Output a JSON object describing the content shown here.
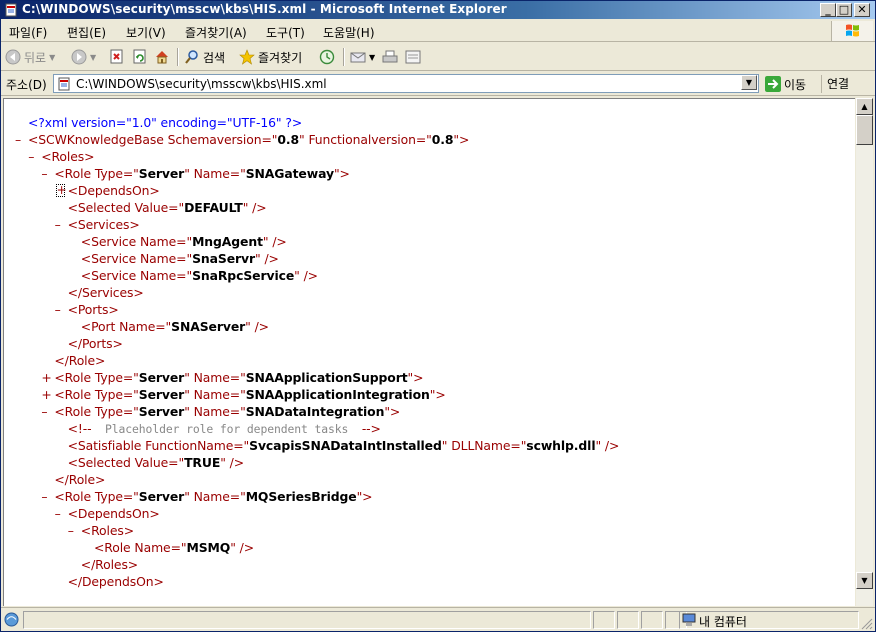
{
  "window": {
    "title": "C:\\WINDOWS\\security\\msscw\\kbs\\HIS.xml - Microsoft Internet Explorer",
    "min_label": "_",
    "max_label": "□",
    "close_label": "✕"
  },
  "menu": {
    "items": [
      "파일(F)",
      "편집(E)",
      "보기(V)",
      "즐겨찾기(A)",
      "도구(T)",
      "도움말(H)"
    ]
  },
  "toolbar": {
    "back_label": "뒤로",
    "search_label": "검색",
    "favorites_label": "즐겨찾기"
  },
  "address": {
    "label": "주소(D)",
    "value": "C:\\WINDOWS\\security\\msscw\\kbs\\HIS.xml",
    "go_label": "이동",
    "links_label": "연결"
  },
  "status": {
    "zone": "내 컴퓨터"
  },
  "xml_lines": [
    {
      "marker": "",
      "indent": 0,
      "parts": [
        {
          "c": "pi",
          "t": "<?xml version=\"1.0\" encoding=\"UTF-16\" ?>"
        }
      ]
    },
    {
      "marker": "-",
      "indent": 0,
      "parts": [
        {
          "c": "tg",
          "t": "<SCWKnowledgeBase "
        },
        {
          "c": "at",
          "t": "Schemaversion=\""
        },
        {
          "c": "vl",
          "t": "0.8"
        },
        {
          "c": "at",
          "t": "\" Functionalversion=\""
        },
        {
          "c": "vl",
          "t": "0.8"
        },
        {
          "c": "tg",
          "t": "\">"
        }
      ]
    },
    {
      "marker": "-",
      "indent": 1,
      "parts": [
        {
          "c": "tg",
          "t": "<Roles>"
        }
      ]
    },
    {
      "marker": "-",
      "indent": 2,
      "parts": [
        {
          "c": "tg",
          "t": "<Role "
        },
        {
          "c": "at",
          "t": "Type=\""
        },
        {
          "c": "vl",
          "t": "Server"
        },
        {
          "c": "at",
          "t": "\" Name=\""
        },
        {
          "c": "vl",
          "t": "SNAGateway"
        },
        {
          "c": "tg",
          "t": "\">"
        }
      ]
    },
    {
      "marker": "+box",
      "indent": 3,
      "parts": [
        {
          "c": "tg",
          "t": "<DependsOn>"
        }
      ]
    },
    {
      "marker": "",
      "indent": 3,
      "parts": [
        {
          "c": "tg",
          "t": "<Selected "
        },
        {
          "c": "at",
          "t": "Value=\""
        },
        {
          "c": "vl",
          "t": "DEFAULT"
        },
        {
          "c": "tg",
          "t": "\" />"
        }
      ]
    },
    {
      "marker": "-",
      "indent": 3,
      "parts": [
        {
          "c": "tg",
          "t": "<Services>"
        }
      ]
    },
    {
      "marker": "",
      "indent": 4,
      "parts": [
        {
          "c": "tg",
          "t": "<Service "
        },
        {
          "c": "at",
          "t": "Name=\""
        },
        {
          "c": "vl",
          "t": "MngAgent"
        },
        {
          "c": "tg",
          "t": "\" />"
        }
      ]
    },
    {
      "marker": "",
      "indent": 4,
      "parts": [
        {
          "c": "tg",
          "t": "<Service "
        },
        {
          "c": "at",
          "t": "Name=\""
        },
        {
          "c": "vl",
          "t": "SnaServr"
        },
        {
          "c": "tg",
          "t": "\" />"
        }
      ]
    },
    {
      "marker": "",
      "indent": 4,
      "parts": [
        {
          "c": "tg",
          "t": "<Service "
        },
        {
          "c": "at",
          "t": "Name=\""
        },
        {
          "c": "vl",
          "t": "SnaRpcService"
        },
        {
          "c": "tg",
          "t": "\" />"
        }
      ]
    },
    {
      "marker": "",
      "indent": 3,
      "parts": [
        {
          "c": "tg",
          "t": "</Services>"
        }
      ]
    },
    {
      "marker": "-",
      "indent": 3,
      "parts": [
        {
          "c": "tg",
          "t": "<Ports>"
        }
      ]
    },
    {
      "marker": "",
      "indent": 4,
      "parts": [
        {
          "c": "tg",
          "t": "<Port "
        },
        {
          "c": "at",
          "t": "Name=\""
        },
        {
          "c": "vl",
          "t": "SNAServer"
        },
        {
          "c": "tg",
          "t": "\" />"
        }
      ]
    },
    {
      "marker": "",
      "indent": 3,
      "parts": [
        {
          "c": "tg",
          "t": "</Ports>"
        }
      ]
    },
    {
      "marker": "",
      "indent": 2,
      "parts": [
        {
          "c": "tg",
          "t": "</Role>"
        }
      ]
    },
    {
      "marker": "+",
      "indent": 2,
      "parts": [
        {
          "c": "tg",
          "t": "<Role "
        },
        {
          "c": "at",
          "t": "Type=\""
        },
        {
          "c": "vl",
          "t": "Server"
        },
        {
          "c": "at",
          "t": "\" Name=\""
        },
        {
          "c": "vl",
          "t": "SNAApplicationSupport"
        },
        {
          "c": "tg",
          "t": "\">"
        }
      ]
    },
    {
      "marker": "+",
      "indent": 2,
      "parts": [
        {
          "c": "tg",
          "t": "<Role "
        },
        {
          "c": "at",
          "t": "Type=\""
        },
        {
          "c": "vl",
          "t": "Server"
        },
        {
          "c": "at",
          "t": "\" Name=\""
        },
        {
          "c": "vl",
          "t": "SNAApplicationIntegration"
        },
        {
          "c": "tg",
          "t": "\">"
        }
      ]
    },
    {
      "marker": "-",
      "indent": 2,
      "parts": [
        {
          "c": "tg",
          "t": "<Role "
        },
        {
          "c": "at",
          "t": "Type=\""
        },
        {
          "c": "vl",
          "t": "Server"
        },
        {
          "c": "at",
          "t": "\" Name=\""
        },
        {
          "c": "vl",
          "t": "SNADataIntegration"
        },
        {
          "c": "tg",
          "t": "\">"
        }
      ]
    },
    {
      "marker": "",
      "indent": 3,
      "parts": [
        {
          "c": "tg",
          "t": "<!--"
        },
        {
          "c": "cm",
          "t": "  Placeholder role for dependent tasks  "
        },
        {
          "c": "tg",
          "t": "-->"
        }
      ]
    },
    {
      "marker": "",
      "indent": 3,
      "parts": [
        {
          "c": "tg",
          "t": "<Satisfiable "
        },
        {
          "c": "at",
          "t": "FunctionName=\""
        },
        {
          "c": "vl",
          "t": "SvcapisSNADataIntInstalled"
        },
        {
          "c": "at",
          "t": "\" DLLName=\""
        },
        {
          "c": "vl",
          "t": "scwhlp.dll"
        },
        {
          "c": "tg",
          "t": "\" />"
        }
      ]
    },
    {
      "marker": "",
      "indent": 3,
      "parts": [
        {
          "c": "tg",
          "t": "<Selected "
        },
        {
          "c": "at",
          "t": "Value=\""
        },
        {
          "c": "vl",
          "t": "TRUE"
        },
        {
          "c": "tg",
          "t": "\" />"
        }
      ]
    },
    {
      "marker": "",
      "indent": 2,
      "parts": [
        {
          "c": "tg",
          "t": "</Role>"
        }
      ]
    },
    {
      "marker": "-",
      "indent": 2,
      "parts": [
        {
          "c": "tg",
          "t": "<Role "
        },
        {
          "c": "at",
          "t": "Type=\""
        },
        {
          "c": "vl",
          "t": "Server"
        },
        {
          "c": "at",
          "t": "\" Name=\""
        },
        {
          "c": "vl",
          "t": "MQSeriesBridge"
        },
        {
          "c": "tg",
          "t": "\">"
        }
      ]
    },
    {
      "marker": "-",
      "indent": 3,
      "parts": [
        {
          "c": "tg",
          "t": "<DependsOn>"
        }
      ]
    },
    {
      "marker": "-",
      "indent": 4,
      "parts": [
        {
          "c": "tg",
          "t": "<Roles>"
        }
      ]
    },
    {
      "marker": "",
      "indent": 5,
      "parts": [
        {
          "c": "tg",
          "t": "<Role "
        },
        {
          "c": "at",
          "t": "Name=\""
        },
        {
          "c": "vl",
          "t": "MSMQ"
        },
        {
          "c": "tg",
          "t": "\" />"
        }
      ]
    },
    {
      "marker": "",
      "indent": 4,
      "parts": [
        {
          "c": "tg",
          "t": "</Roles>"
        }
      ]
    },
    {
      "marker": "",
      "indent": 3,
      "parts": [
        {
          "c": "tg",
          "t": "</DependsOn>"
        }
      ]
    }
  ]
}
